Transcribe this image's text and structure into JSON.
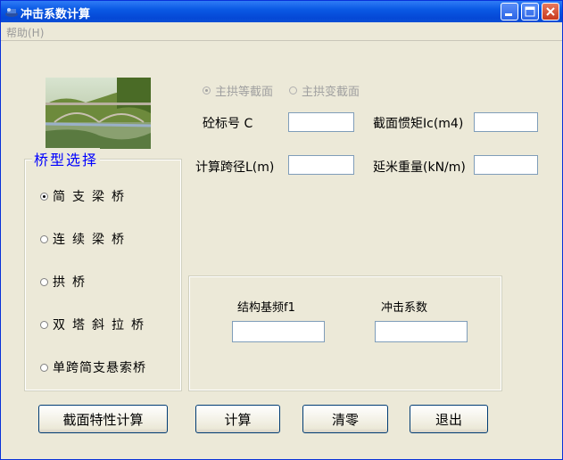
{
  "window": {
    "title": "冲击系数计算"
  },
  "menu": {
    "help": "帮助(H)"
  },
  "arch": {
    "option_uniform": "主拱等截面",
    "option_variable": "主拱变截面",
    "selected": "主拱等截面"
  },
  "inputs": {
    "concrete_grade_label": "砼标号 C",
    "inertia_label": "截面惯矩Ic(m4)",
    "span_label": "计算跨径L(m)",
    "weight_label": "延米重量(kN/m)",
    "concrete_grade_value": "",
    "inertia_value": "",
    "span_value": "",
    "weight_value": ""
  },
  "bridge_type": {
    "title": "桥型选择",
    "selected": "简支梁桥",
    "options": [
      "简支梁桥",
      "连续梁桥",
      "拱桥",
      "双塔斜拉桥",
      "单跨简支悬索桥"
    ]
  },
  "results": {
    "frequency_label": "结构基频f1",
    "impact_label": "冲击系数",
    "frequency_value": "",
    "impact_value": ""
  },
  "buttons": {
    "section_calc": "截面特性计算",
    "calculate": "计算",
    "clear": "清零",
    "exit": "退出"
  },
  "colors": {
    "titlebar": "#0a59e4",
    "group_title": "#0000ff",
    "background": "#ece9d8"
  },
  "icons": {
    "app": "bridge-app-icon",
    "minimize": "minimize-icon",
    "maximize": "maximize-icon",
    "close": "close-icon"
  }
}
